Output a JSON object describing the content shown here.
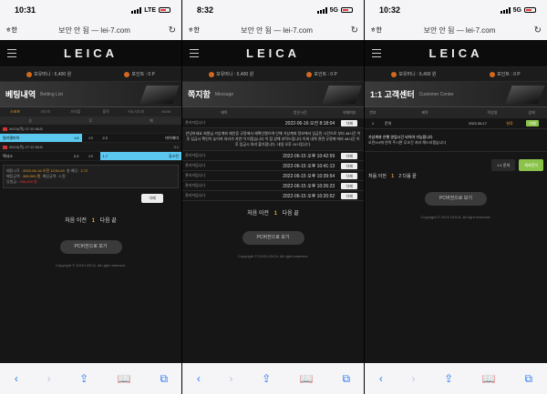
{
  "panels": [
    {
      "time": "10:31",
      "network": "LTE",
      "address": {
        "aa": "ㅎ한",
        "url": "보안 안 됨 — lei-7.com"
      },
      "logo": "LEICA",
      "points": {
        "money": "보유머니 : 6,400 원",
        "point": "포인트 : 0 P"
      },
      "title": "베팅내역",
      "subtitle": "Betting List",
      "tabs": [
        "스포츠",
        "사다리",
        "파워볼",
        "홀짝",
        "키노사다리",
        "MGM"
      ],
      "cols": [
        "승",
        "무",
        "패"
      ],
      "game1": {
        "league": "06/16(목) 07:10 MLB",
        "home": "필라델피아",
        "home_odds": "1.6",
        "vs": "VS",
        "draw_odds": "2.2",
        "away": "마이애미",
        "away_odds": "3.1"
      },
      "game2": {
        "league": "06/16(목) 07:10 MLB",
        "home": "텍사스",
        "home_odds": "2.2",
        "vs": "VS",
        "away_odds": "1.7",
        "away": "휴스턴",
        "extra": "2.9"
      },
      "bet": {
        "time_label": "배팅시각 :",
        "time": "2022-06-16 오전 12:51:03",
        "amount_label": "배팅금액 :",
        "amount": "345,000 원",
        "odds_label": "총 배당 :",
        "odds": "2.72",
        "expected_label": "예상금액 :",
        "expected": "0 원",
        "win_label": "당첨금 :",
        "win": "938,400 원"
      },
      "delete": "삭제",
      "pager": {
        "first": "처음",
        "prev": "이전",
        "cur": "1",
        "next": "다음",
        "last": "끝"
      },
      "pc": "PC버전으로 보기",
      "copyright": "Copyright © 2015 LEICA. All right reserved."
    },
    {
      "time": "8:32",
      "network": "5G",
      "address": {
        "aa": "ㅎ한",
        "url": "보안 안 됨 — lei-7.com"
      },
      "logo": "LEICA",
      "points": {
        "money": "보유머니 : 6,400 원",
        "point": "포인트 : 0 P"
      },
      "title": "쪽지함",
      "subtitle": "Message",
      "headers": [
        "제목",
        "받은시간",
        "삭제여부"
      ],
      "first_row": {
        "subject": "관리자입니다",
        "date": "2022-06-16 오전 8:18:04",
        "btn": "삭제"
      },
      "body": "안녕하세요 회원님 가상계좌 재인증 규정에서 재확인됐으며 인해 가상계좌 정보에서 입금된 시간으로 부터 48시간 이후 입금시 확인이 늦어져 처리가 지연 이 어렵습니다 이 점 양해 부탁드립니다 이외 내역 관련 규정에 따라 48시간 이후 입금시 처리 불가합니다. 내일 오후 10시입니다.",
      "rows": [
        {
          "subject": "관리자입니다",
          "date": "2022-06-15 오후 10:42:59",
          "btn": "삭제"
        },
        {
          "subject": "관리자입니다",
          "date": "2022-06-15 오후 10:41:13",
          "btn": "삭제"
        },
        {
          "subject": "관리자입니다",
          "date": "2022-06-15 오후 10:39:54",
          "btn": "삭제"
        },
        {
          "subject": "관리자입니다",
          "date": "2022-06-15 오후 10:26:23",
          "btn": "삭제"
        },
        {
          "subject": "관리자입니다",
          "date": "2022-06-15 오후 10:20:52",
          "btn": "삭제"
        }
      ],
      "pager": {
        "first": "처음",
        "prev": "이전",
        "cur": "1",
        "next": "다음",
        "last": "끝"
      },
      "pc": "PC버전으로 보기",
      "copyright": "Copyright © 2015 LEICA. All right reserved."
    },
    {
      "time": "10:32",
      "network": "5G",
      "address": {
        "aa": "ㅎ한",
        "url": "보안 안 됨 — lei-7.com"
      },
      "logo": "LEICA",
      "points": {
        "money": "보유머니 : 6,400 원",
        "point": "포인트 : 0 P"
      },
      "title": "1:1 고객센터",
      "subtitle": "Customer Center",
      "headers": [
        "번호",
        "제목",
        "작성일",
        "상태"
      ],
      "row": {
        "no": "1",
        "subject": "문의",
        "date": "2022.06.17",
        "status": "완료",
        "btn": "삭제"
      },
      "answer_line1": "가상계좌 은행 영업시간 되어야 가능합니다",
      "answer_line2": "오전9시에 연락 주시면 무조건 처리 해드리겠습니다",
      "pager": {
        "first": "처음",
        "prev": "이전",
        "cur": "1",
        "next": "2",
        "last": "다음 끝"
      },
      "btn_inquiry": "1:1 문의",
      "btn_account": "계좌문의",
      "pc": "PC버전으로 보기",
      "copyright": "Copyright © 2015 LEICA. All right reserved."
    }
  ],
  "toolbar": {
    "back": "‹",
    "forward": "›",
    "share": "⇪",
    "bookmarks": "📖",
    "tabs": "⧉"
  }
}
